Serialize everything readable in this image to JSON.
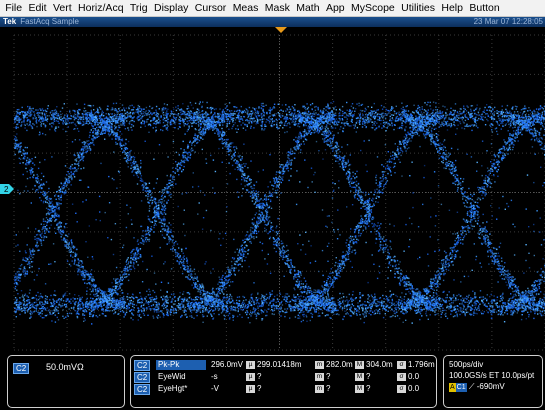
{
  "menu": [
    "File",
    "Edit",
    "Vert",
    "Horiz/Acq",
    "Trig",
    "Display",
    "Cursor",
    "Meas",
    "Mask",
    "Math",
    "App",
    "MyScope",
    "Utilities",
    "Help",
    "Button"
  ],
  "titlebar": {
    "logo": "Tek",
    "mode": "FastAcq Sample",
    "datetime": "23 Mar 07 12:28:05"
  },
  "channel": {
    "tag": "C2",
    "scale": "50.0mVΩ",
    "marker": "2"
  },
  "measurements": [
    {
      "tag": "C2",
      "name": "Pk-Pk",
      "highlight": true,
      "value": "296.0mV",
      "mu": "299.01418m",
      "m": "282.0m",
      "M": "304.0m",
      "sigma": "1.796m"
    },
    {
      "tag": "C2",
      "name": "EyeWid",
      "highlight": false,
      "value": "-s",
      "mu": "?",
      "m": "?",
      "M": "?",
      "sigma": "0.0"
    },
    {
      "tag": "C2",
      "name": "EyeHgt*",
      "highlight": false,
      "value": "-V",
      "mu": "?",
      "m": "?",
      "M": "?",
      "sigma": "0.0"
    }
  ],
  "stat_labels": {
    "mu": "µ",
    "m": "m",
    "M": "M",
    "sigma": "σ"
  },
  "timebase": {
    "line1": "500ps/div",
    "line2": "100.0GS/s ET 10.0ps/pt",
    "trig_source": "A",
    "trig_channel": "C1",
    "trig_level": "-690mV"
  },
  "colors": {
    "trace": "#2a86ff",
    "channel": "#1d5fb0",
    "trigger_marker": "#e89a1a",
    "channel_marker": "#33d4e8"
  }
}
